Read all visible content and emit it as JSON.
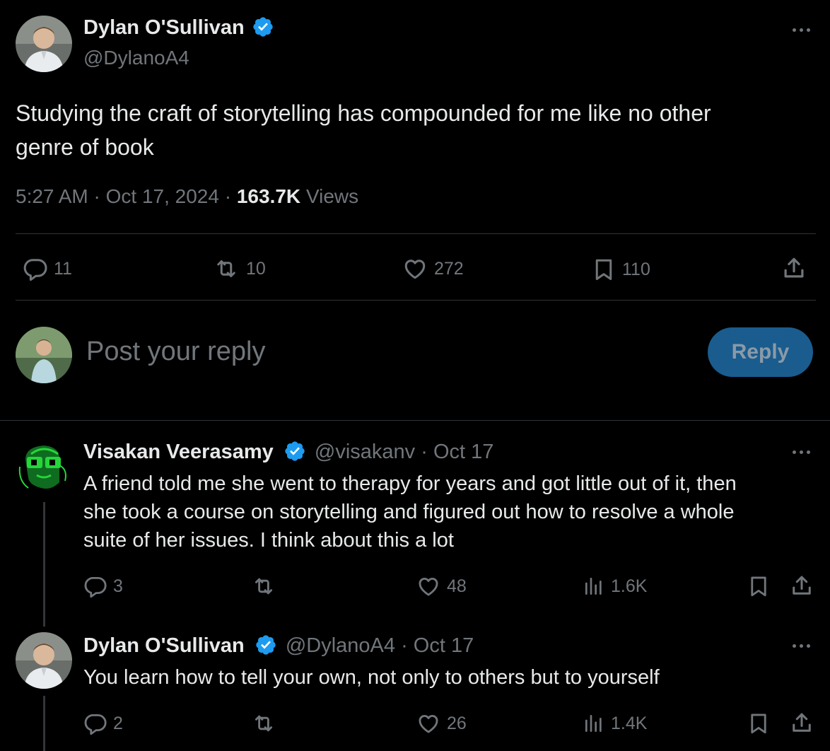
{
  "main_tweet": {
    "author_name": "Dylan O'Sullivan",
    "handle": "@DylanoA4",
    "text_line1": "Studying the craft of storytelling has compounded for me like no other",
    "text_line2": "genre of book",
    "time": "5:27 AM",
    "sep1": "·",
    "date": "Oct 17, 2024",
    "sep2": "·",
    "views": "163.7K",
    "views_label": "Views",
    "replies": "11",
    "reposts": "10",
    "likes": "272",
    "bookmarks": "110"
  },
  "reply_box": {
    "placeholder": "Post your reply",
    "button": "Reply"
  },
  "replies": [
    {
      "author_name": "Visakan Veerasamy",
      "handle": "@visakanv",
      "dot": "·",
      "date": "Oct 17",
      "line1": "A friend told me she went to therapy for years and got little out of it, then",
      "line2": "she took a course on storytelling and figured out how to resolve a whole",
      "line3": "suite of her issues. I think about this a lot",
      "replies": "3",
      "likes": "48",
      "views": "1.6K"
    },
    {
      "author_name": "Dylan O'Sullivan",
      "handle": "@DylanoA4",
      "dot": "·",
      "date": "Oct 17",
      "line1": "You learn how to tell your own, not only to others but to yourself",
      "replies": "2",
      "likes": "26",
      "views": "1.4K"
    }
  ],
  "colors": {
    "background": "#000000",
    "text": "#e7e9ea",
    "muted": "#71767b",
    "verified": "#1d9bf0",
    "reply_button": "#1a5c8e"
  }
}
